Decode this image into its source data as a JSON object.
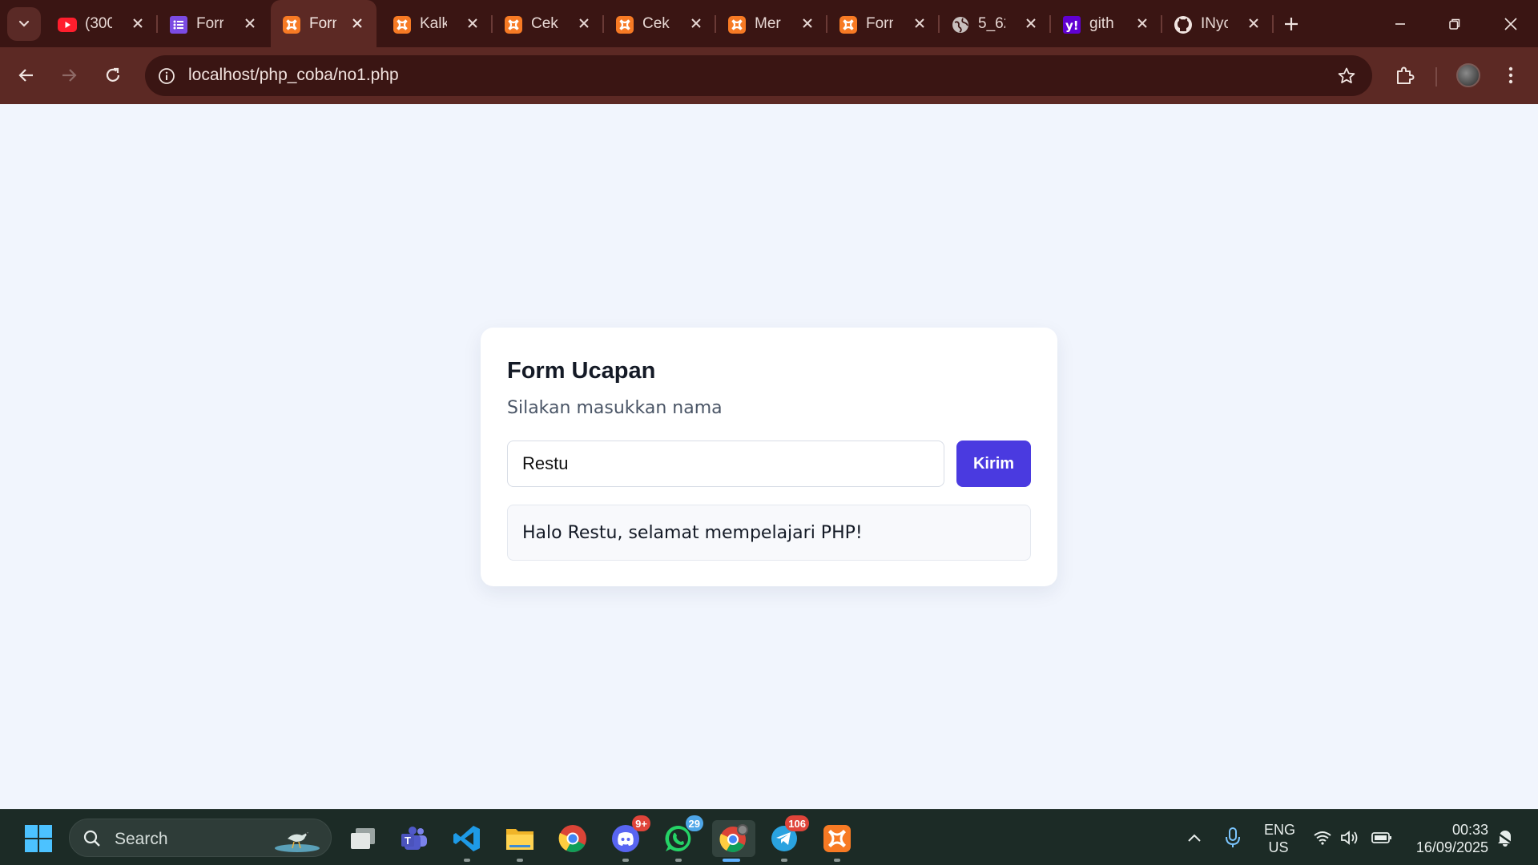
{
  "browser": {
    "tabs": [
      {
        "icon": "youtube-icon",
        "title": "(300"
      },
      {
        "icon": "forms-icon",
        "title": "Forr"
      },
      {
        "icon": "xampp-icon",
        "title": "Forn",
        "active": true
      },
      {
        "icon": "xampp-icon",
        "title": "Kalk"
      },
      {
        "icon": "xampp-icon",
        "title": "Cek"
      },
      {
        "icon": "xampp-icon",
        "title": "Cek"
      },
      {
        "icon": "xampp-icon",
        "title": "Mer"
      },
      {
        "icon": "xampp-icon",
        "title": "Forn"
      },
      {
        "icon": "globe-icon",
        "title": "5_62"
      },
      {
        "icon": "yahoo-icon",
        "title": "gith"
      },
      {
        "icon": "github-icon",
        "title": "INyo"
      }
    ],
    "url": "localhost/php_coba/no1.php"
  },
  "page": {
    "title": "Form Ucapan",
    "subtitle": "Silakan masukkan nama",
    "name_value": "Restu",
    "submit_label": "Kirim",
    "result_text": "Halo Restu, selamat mempelajari PHP!"
  },
  "taskbar": {
    "search_label": "Search",
    "apps": [
      {
        "icon": "task-view-icon"
      },
      {
        "icon": "teams-icon"
      },
      {
        "icon": "vscode-icon"
      },
      {
        "icon": "file-explorer-icon"
      },
      {
        "icon": "chrome-icon"
      },
      {
        "icon": "discord-icon",
        "badge": "9+"
      },
      {
        "icon": "whatsapp-icon",
        "badge": "29"
      },
      {
        "icon": "chrome-profile-icon",
        "active": true
      },
      {
        "icon": "telegram-icon",
        "badge": "106"
      },
      {
        "icon": "xampp-icon"
      }
    ],
    "lang_line1": "ENG",
    "lang_line2": "US",
    "time": "00:33",
    "date": "16/09/2025"
  }
}
